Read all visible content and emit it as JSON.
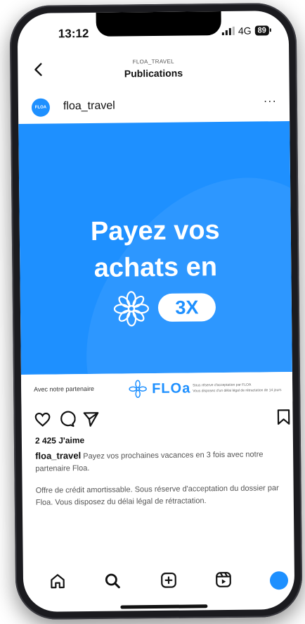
{
  "status_bar": {
    "time": "13:12",
    "network": "4G",
    "battery": "89"
  },
  "top_bar": {
    "account": "FLOA_TRAVEL",
    "title": "Publications"
  },
  "post": {
    "avatar_text": "FLOA",
    "username": "floa_travel",
    "more": "···",
    "banner": {
      "line1": "Payez vos",
      "line2": "achats en",
      "badge": "3X",
      "color": "#1e90ff"
    },
    "partner": {
      "label": "Avec notre partenaire",
      "brand": "FLOa",
      "legal1": "Sous réserve d'acceptation par FLOA",
      "legal2": "Vous disposez d'un délai légal de rétractation de 14 jours"
    },
    "likes": "2 425 J'aime",
    "caption_user": "floa_travel",
    "caption_text": "Payez  vos prochaines vacances en 3 fois avec notre partenaire Floa.",
    "disclaimer": "Offre de crédit amortissable. Sous réserve d'acceptation du dossier par Floa. Vous disposez du délai légal de rétractation."
  },
  "icons": [
    "back-icon",
    "more-icon",
    "heart-icon",
    "comment-icon",
    "share-icon",
    "bookmark-icon",
    "home-icon",
    "search-icon",
    "add-icon",
    "reels-icon",
    "profile-icon"
  ]
}
